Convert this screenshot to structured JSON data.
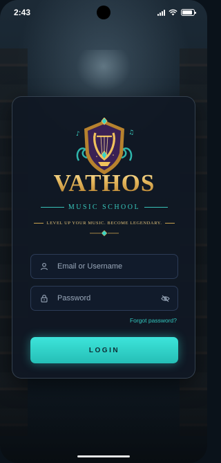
{
  "status_bar": {
    "time": "2:43",
    "battery_level": 0.9
  },
  "brand": {
    "title": "VATHOS",
    "subtitle": "MUSIC SCHOOL",
    "tagline": "LEVEL UP YOUR MUSIC. BECOME LEGENDARY."
  },
  "form": {
    "email_placeholder": "Email or Username",
    "password_placeholder": "Password",
    "forgot_label": "Forgot password?",
    "login_label": "LOGIN"
  },
  "icons": {
    "crest": "lyre-crest-icon",
    "email": "user-icon",
    "password": "lock-icon",
    "visibility": "eye-off-icon"
  },
  "colors": {
    "accent_teal": "#32c8bf",
    "brand_gold": "#e2b45a",
    "card_bg": "#101824"
  }
}
